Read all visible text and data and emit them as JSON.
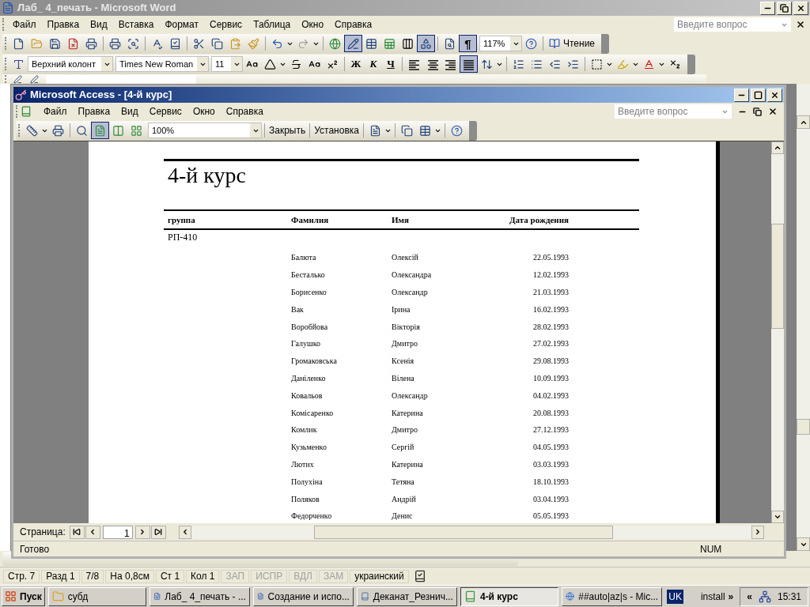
{
  "word": {
    "title": "Лаб_ 4_печать - Microsoft Word",
    "menu": [
      "Файл",
      "Правка",
      "Вид",
      "Вставка",
      "Формат",
      "Сервис",
      "Таблица",
      "Окно",
      "Справка"
    ],
    "help_placeholder": "Введите вопрос",
    "standard_toolbar": {
      "show_marks": {
        "label": "¶",
        "on": true
      },
      "zoom": "117%",
      "reading": "Чтение"
    },
    "format_toolbar": {
      "style": "Верхний колонт",
      "font": "Times New Roman",
      "size": "11",
      "bold": "Ж",
      "italic": "К",
      "underline": "Ч",
      "align": [
        {
          "selected": false
        },
        {
          "selected": false
        },
        {
          "selected": false
        },
        {
          "selected": true
        }
      ]
    },
    "status_bar": [
      {
        "text": "Стр. 7",
        "disabled": false
      },
      {
        "text": "Разд 1",
        "disabled": false
      },
      {
        "text": "7/8",
        "disabled": false
      },
      {
        "text": "На 0,8см",
        "disabled": false
      },
      {
        "text": "Ст 1",
        "disabled": false
      },
      {
        "text": "Кол 1",
        "disabled": false
      },
      {
        "text": "ЗАП",
        "disabled": true
      },
      {
        "text": "ИСПР",
        "disabled": true
      },
      {
        "text": "ВДЛ",
        "disabled": true
      },
      {
        "text": "ЗАМ",
        "disabled": true
      },
      {
        "text": "украинский",
        "disabled": false
      }
    ]
  },
  "access": {
    "title": "Microsoft Access - [4-й курс]",
    "menu": [
      "Файл",
      "Правка",
      "Вид",
      "Сервис",
      "Окно",
      "Справка"
    ],
    "help_placeholder": "Введите вопрос",
    "toolbar": {
      "views": [
        {
          "selected": true
        },
        {
          "selected": false
        },
        {
          "selected": false
        }
      ],
      "zoom": "100%",
      "close": "Закрыть",
      "setup": "Установка"
    },
    "report": {
      "title": "4-й курс",
      "columns": [
        "группа",
        "Фамилия",
        "Имя",
        "Дата рождения"
      ],
      "group": "РП-410",
      "rows": [
        {
          "surname": "Балюта",
          "name": "Олексій",
          "date": "22.05.1993"
        },
        {
          "surname": "Бесталько",
          "name": "Олександра",
          "date": "12.02.1993"
        },
        {
          "surname": "Борисенко",
          "name": "Олександр",
          "date": "21.03.1993"
        },
        {
          "surname": "Вак",
          "name": "Ірина",
          "date": "16.02.1993"
        },
        {
          "surname": "Воробйова",
          "name": "Вікторія",
          "date": "28.02.1993"
        },
        {
          "surname": "Галушко",
          "name": "Дмитро",
          "date": "27.02.1993"
        },
        {
          "surname": "Громаковська",
          "name": "Ксенія",
          "date": "29.08.1993"
        },
        {
          "surname": "Даніленко",
          "name": "Вілена",
          "date": "10.09.1993"
        },
        {
          "surname": "Ковальов",
          "name": "Олександр",
          "date": "04.02.1993"
        },
        {
          "surname": "Комісаренко",
          "name": "Катерина",
          "date": "20.08.1993"
        },
        {
          "surname": "Комлик",
          "name": "Дмитро",
          "date": "27.12.1993"
        },
        {
          "surname": "Кузьменко",
          "name": "Сергій",
          "date": "04.05.1993"
        },
        {
          "surname": "Лютих",
          "name": "Катерина",
          "date": "03.03.1993"
        },
        {
          "surname": "Полухіна",
          "name": "Тетяна",
          "date": "18.10.1993"
        },
        {
          "surname": "Поляков",
          "name": "Андрій",
          "date": "03.04.1993"
        },
        {
          "surname": "Федорченко",
          "name": "Денис",
          "date": "05.05.1993"
        }
      ]
    },
    "nav": {
      "label": "Страница:",
      "page": "1"
    },
    "status": {
      "text": "Готово",
      "num": "NUM"
    }
  },
  "taskbar": {
    "start": "Пуск",
    "buttons": [
      {
        "label": "субд",
        "kind": "folder",
        "selected": false
      },
      {
        "label": "Лаб_ 4_печать - ...",
        "kind": "word",
        "selected": false
      },
      {
        "label": "Создание и испо...",
        "kind": "word",
        "selected": false
      },
      {
        "label": "Деканат_Резнич...",
        "kind": "access",
        "selected": false
      },
      {
        "label": "4-й курс",
        "kind": "report",
        "selected": true
      },
      {
        "label": "##auto|az|s - Mic...",
        "kind": "browser",
        "selected": false
      }
    ],
    "language": "UK",
    "toolbar_label": "install",
    "more": "»",
    "tray_toggle": "«",
    "clock": "15:31"
  }
}
